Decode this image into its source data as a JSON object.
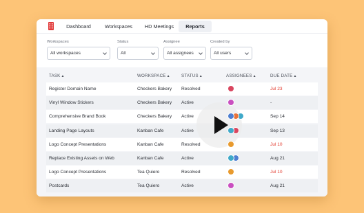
{
  "nav": {
    "tabs": [
      {
        "label": "Dashboard",
        "active": false
      },
      {
        "label": "Workspaces",
        "active": false
      },
      {
        "label": "HD Meetings",
        "active": false
      },
      {
        "label": "Reports",
        "active": true
      }
    ],
    "logo_icon": "building-icon",
    "logo_color": "#E23B3B"
  },
  "filters": {
    "workspaces": {
      "label": "Workspaces",
      "value": "All workspaces"
    },
    "status": {
      "label": "Status",
      "value": "All"
    },
    "assignee": {
      "label": "Assignee",
      "value": "All assignees"
    },
    "created_by": {
      "label": "Created by",
      "value": "All users"
    }
  },
  "table": {
    "headers": [
      "TASK",
      "WORKSPACE",
      "STATUS",
      "ASSIGNEES",
      "DUE DATE"
    ],
    "rows": [
      {
        "task": "Register Domain Name",
        "workspace": "Checkers Bakery",
        "status": "Resolved",
        "assignees": [
          "#D9465F"
        ],
        "due": "Jul 23",
        "due_overdue": true
      },
      {
        "task": "Vinyl Window Stickers",
        "workspace": "Checkers Bakery",
        "status": "Active",
        "assignees": [
          "#C94FC0"
        ],
        "due": "-",
        "due_overdue": false
      },
      {
        "task": "Comprehensive Brand Book",
        "workspace": "Checkers Bakery",
        "status": "Active",
        "assignees": [
          "#4E7FD1",
          "#E8733A",
          "#3FA9C9"
        ],
        "due": "Sep 14",
        "due_overdue": false
      },
      {
        "task": "Landing Page Layouts",
        "workspace": "Kanban Cafe",
        "status": "Active",
        "assignees": [
          "#3FA9C9",
          "#D9465F"
        ],
        "due": "Sep 13",
        "due_overdue": false
      },
      {
        "task": "Logo Concept Presentations",
        "workspace": "Kanban Cafe",
        "status": "Resolved",
        "assignees": [
          "#E89A2E"
        ],
        "due": "Jul 10",
        "due_overdue": true
      },
      {
        "task": "Replace Existing Assets on Web",
        "workspace": "Kanban Cafe",
        "status": "Active",
        "assignees": [
          "#3FA9C9",
          "#4E7FD1"
        ],
        "due": "Aug 21",
        "due_overdue": false
      },
      {
        "task": "Logo Concept Presentations",
        "workspace": "Tea Quiero",
        "status": "Resolved",
        "assignees": [
          "#E89A2E"
        ],
        "due": "Jul 10",
        "due_overdue": true
      },
      {
        "task": "Postcards",
        "workspace": "Tea Quiero",
        "status": "Active",
        "assignees": [
          "#C94FC0"
        ],
        "due": "Aug 21",
        "due_overdue": false
      }
    ]
  },
  "overlay": {
    "icon": "play-icon"
  },
  "colors": {
    "background": "#FDC477",
    "overdue": "#E2382B"
  }
}
